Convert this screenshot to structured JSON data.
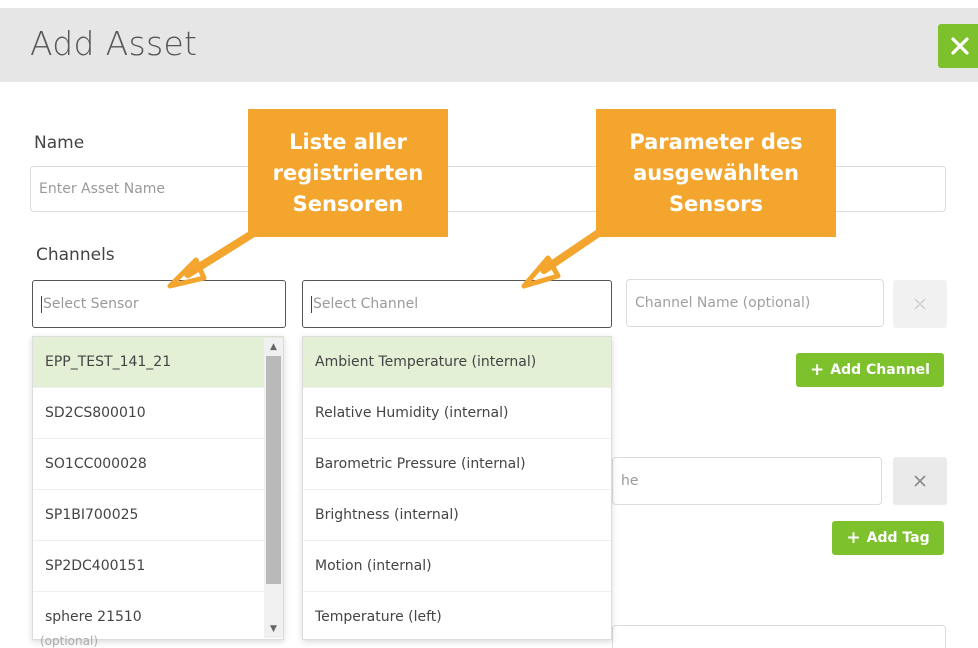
{
  "modal": {
    "title": "Add Asset",
    "close_icon": "close-icon"
  },
  "form": {
    "name_label": "Name",
    "name_placeholder": "Enter Asset Name",
    "channels_label": "Channels",
    "sensor_placeholder": "Select Sensor",
    "channel_placeholder": "Select Channel",
    "channel_name_placeholder": "Channel Name (optional)",
    "add_channel_label": "Add Channel",
    "add_tag_label": "Add Tag",
    "tag_field_partial": "he",
    "bottom_partial": "(optional)"
  },
  "sensor_list": {
    "items": [
      "EPP_TEST_141_21",
      "SD2CS800010",
      "SO1CC000028",
      "SP1BI700025",
      "SP2DC400151",
      "sphere 21510"
    ],
    "selected_index": 0
  },
  "channel_list": {
    "items": [
      "Ambient Temperature (internal)",
      "Relative Humidity (internal)",
      "Barometric Pressure (internal)",
      "Brightness (internal)",
      "Motion (internal)",
      "Temperature (left)"
    ],
    "selected_index": 0
  },
  "callouts": {
    "sensors": [
      "Liste aller",
      "registrierten",
      "Sensoren"
    ],
    "parameters": [
      "Parameter des",
      "ausgewählten",
      "Sensors"
    ]
  },
  "colors": {
    "accent_green": "#7dc12c",
    "callout_orange": "#f3a52e",
    "highlight_green": "#e3f0d6"
  }
}
